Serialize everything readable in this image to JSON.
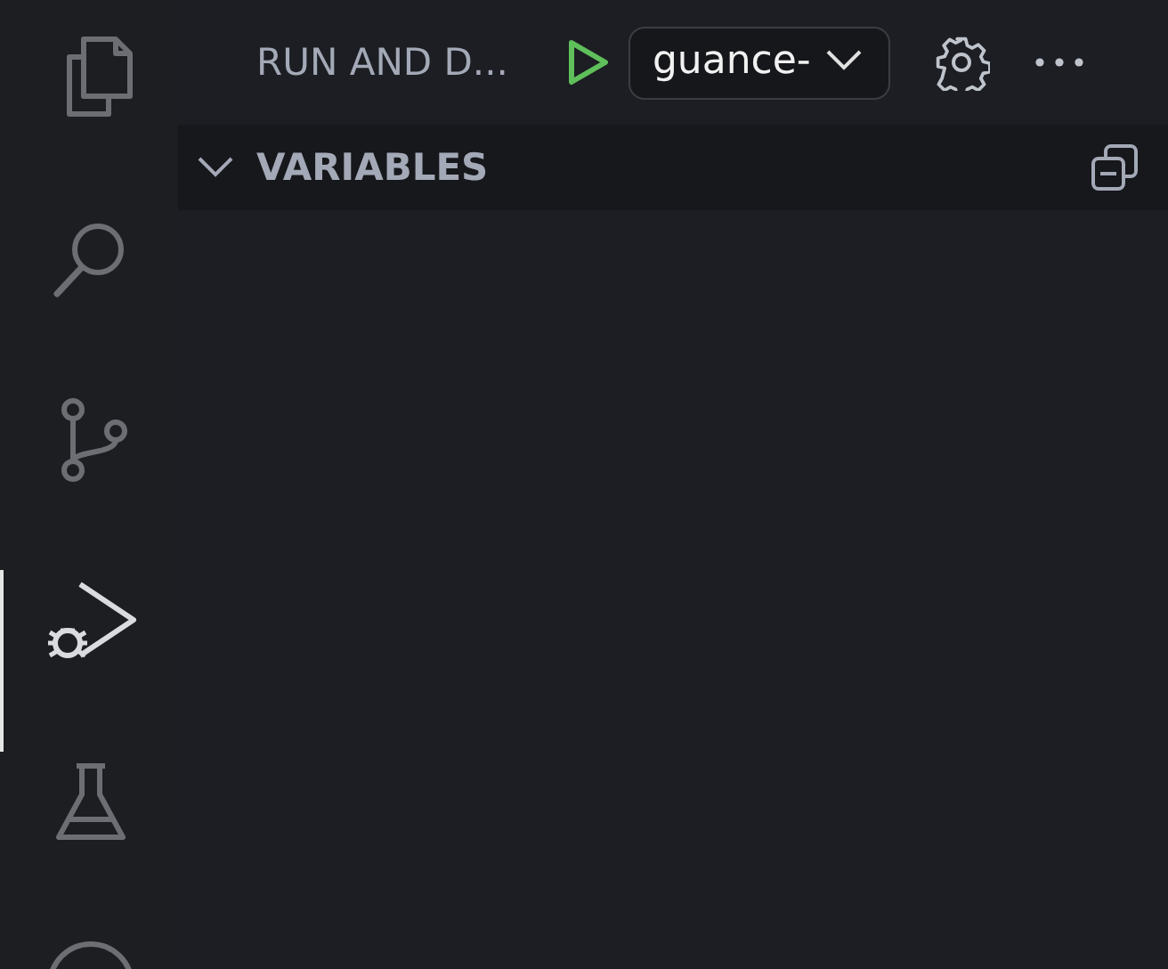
{
  "activity_bar": {
    "items": [
      {
        "kind": "explorer",
        "selected": false
      },
      {
        "kind": "search",
        "selected": false
      },
      {
        "kind": "source-control",
        "selected": false
      },
      {
        "kind": "run-debug",
        "selected": true
      },
      {
        "kind": "testing",
        "selected": false
      },
      {
        "kind": "remote",
        "selected": false
      }
    ]
  },
  "header": {
    "title": "RUN AND D...",
    "configuration": "guance-"
  },
  "sections": [
    {
      "title": "VARIABLES",
      "expanded": true
    }
  ]
}
